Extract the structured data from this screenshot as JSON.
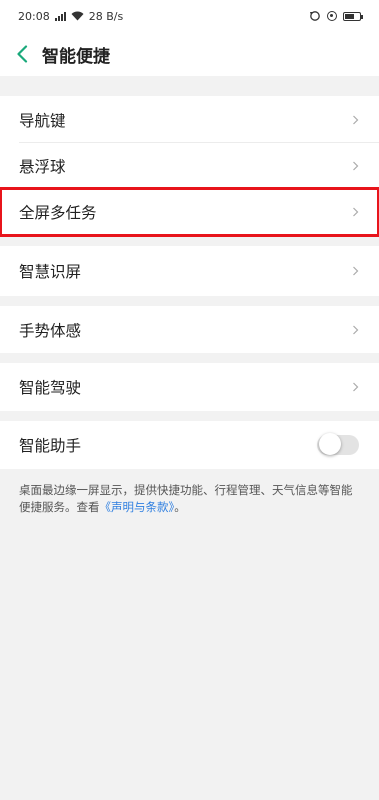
{
  "status_bar": {
    "time": "20:08",
    "network_speed": "28 B/s",
    "icons": [
      "signal-icon",
      "wifi-icon",
      "ring-icon",
      "sync-icon",
      "battery-icon"
    ]
  },
  "header": {
    "title": "智能便捷",
    "back_icon": "chevron-left-icon"
  },
  "colors": {
    "accent": "#1aa97b",
    "highlight_border": "#e8141b",
    "link": "#2f7fe0",
    "background": "#f2f2f2"
  },
  "settings": {
    "group1": [
      {
        "label": "导航键"
      },
      {
        "label": "悬浮球"
      },
      {
        "label": "全屏多任务",
        "highlighted": true
      }
    ],
    "smart_screen": {
      "label": "智慧识屏"
    },
    "gesture": {
      "label": "手势体感"
    },
    "driving": {
      "label": "智能驾驶"
    },
    "assistant": {
      "label": "智能助手",
      "enabled": false
    }
  },
  "description": {
    "text": "桌面最边缘一屏显示，提供快捷功能、行程管理、天气信息等智能便捷服务。查看",
    "link": "《声明与条款》",
    "suffix": "。"
  }
}
